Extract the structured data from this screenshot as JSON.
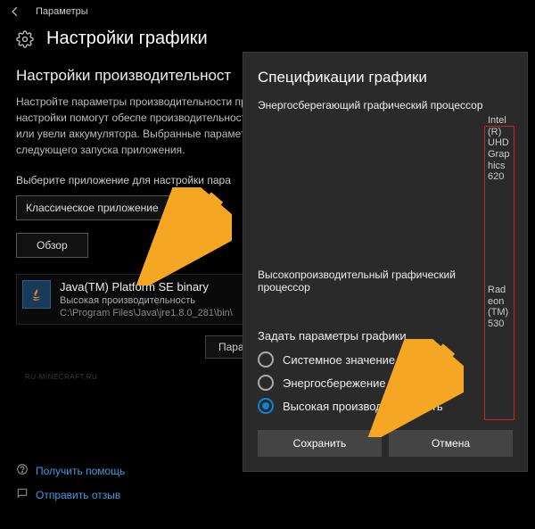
{
  "titlebar": {
    "app_name": "Параметры"
  },
  "header": {
    "title": "Настройки графики"
  },
  "main": {
    "subhead": "Настройки производительност",
    "description": "Настройте параметры производительности приложений. Эти настройки помогут обеспе производительность приложения или увели аккумулятора. Выбранные параметры вступ следующего запуска приложения.",
    "select_label": "Выберите приложение для настройки пара",
    "dropdown_value": "Классическое приложение",
    "browse_label": "Обзор",
    "app": {
      "name": "Java(TM) Platform SE binary",
      "perf": "Высокая производительность",
      "path": "C:\\Program Files\\Java\\jre1.8.0_281\\bin\\"
    },
    "options_label": "Пара"
  },
  "footer": {
    "help": "Получить помощь",
    "feedback": "Отправить отзыв"
  },
  "dialog": {
    "title": "Спецификации графики",
    "gpu1_label": "Энергосберегающий графический процессор",
    "gpu1_name": "Intel(R) UHD Graphics 620",
    "gpu2_label": "Высокопроизводительный графический процессор",
    "gpu2_name": "Radeon (TM) 530",
    "radio_title": "Задать параметры графики",
    "radios": [
      {
        "label": "Системное значение по ум       нию"
      },
      {
        "label": "Энергосбережение"
      },
      {
        "label": "Высокая производительность"
      }
    ],
    "save": "Сохранить",
    "cancel": "Отмена"
  },
  "watermark": "RU-MINECRAFT.RU"
}
